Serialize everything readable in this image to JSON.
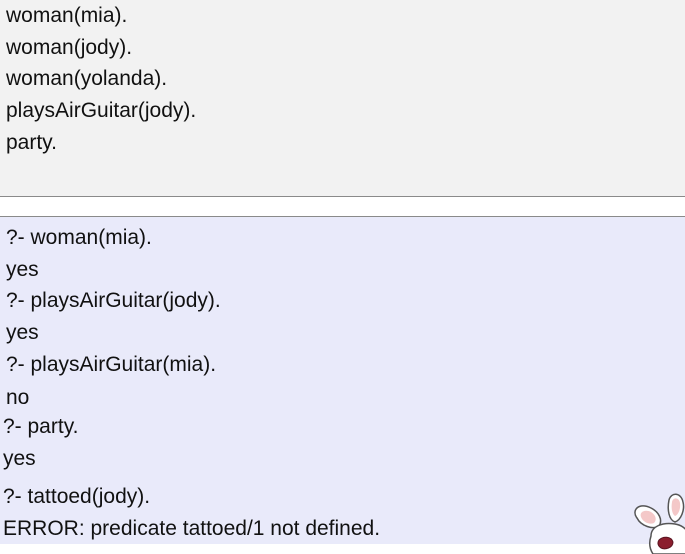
{
  "knowledge_base": {
    "facts": [
      "woman(mia).",
      "woman(jody).",
      "woman(yolanda).",
      "playsAirGuitar(jody).",
      "party."
    ]
  },
  "console": {
    "lines": [
      "?- woman(mia).",
      "yes",
      "?- playsAirGuitar(jody).",
      "yes",
      "?- playsAirGuitar(mia).",
      "no",
      "?- party.",
      "yes",
      "?- tattoed(jody).",
      "ERROR: predicate tattoed/1 not defined."
    ]
  },
  "colors": {
    "kb_background": "#f2f2f2",
    "console_background": "#e9eafa",
    "text": "#111111"
  },
  "icons": {
    "mascot": "rabbit-mascot-icon"
  }
}
